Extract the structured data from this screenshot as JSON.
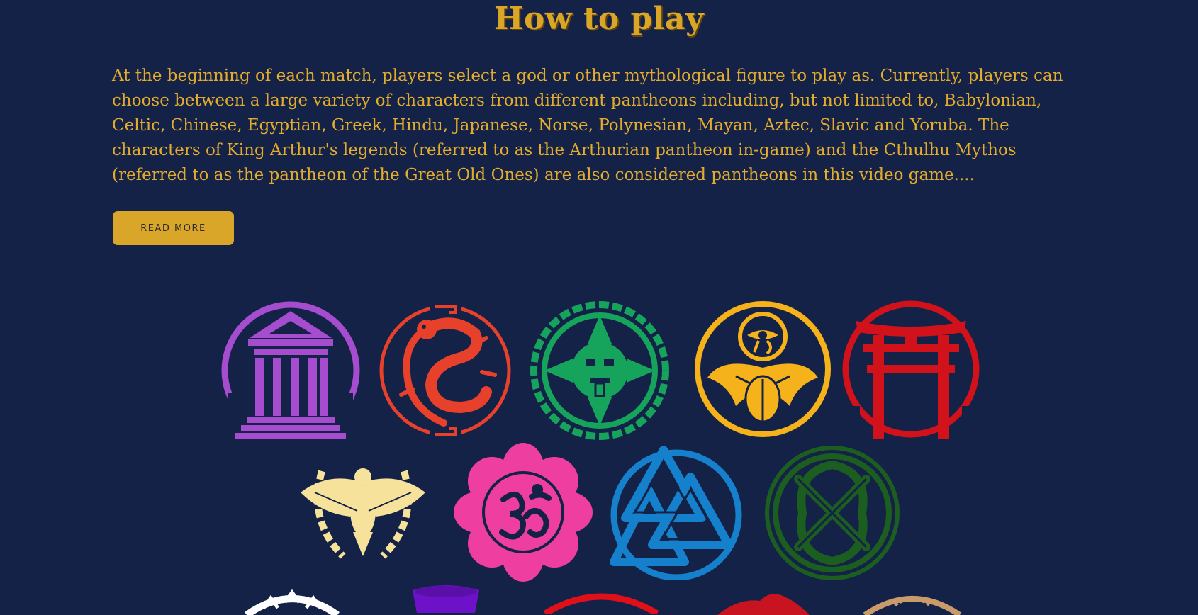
{
  "section": {
    "title": "How to play",
    "description": "At the beginning of each match, players select a god or other mythological figure to play as. Currently, players can choose between a large variety of characters from different pantheons including, but not limited to, Babylonian, Celtic, Chinese, Egyptian, Greek, Hindu, Japanese, Norse, Polynesian, Mayan, Aztec, Slavic and Yoruba. The characters of King Arthur's legends (referred to as the Arthurian pantheon in-game) and the Cthulhu Mythos (referred to as the pantheon of the Great Old Ones) are also considered pantheons in this video game....",
    "read_more_label": "READ MORE"
  },
  "colors": {
    "background": "#152247",
    "accent": "#d9a628",
    "greek": "#a54ccf",
    "chinese": "#e8412b",
    "mayan": "#16a35c",
    "egyptian": "#f5b21b",
    "japanese": "#d1121b",
    "roman": "#f6e29a",
    "hindu": "#ee3fa0",
    "norse": "#1580cc",
    "celtic": "#1b5e20"
  },
  "emblems": [
    {
      "icon": "greek-temple-icon"
    },
    {
      "icon": "chinese-dragon-icon"
    },
    {
      "icon": "mayan-sun-icon"
    },
    {
      "icon": "egyptian-scarab-icon"
    },
    {
      "icon": "japanese-torii-icon"
    },
    {
      "icon": "roman-eagle-icon"
    },
    {
      "icon": "hindu-om-lotus-icon"
    },
    {
      "icon": "norse-valknut-icon"
    },
    {
      "icon": "celtic-knot-icon"
    },
    {
      "icon": "voodoo-icon"
    },
    {
      "icon": "purple-emblem-icon"
    },
    {
      "icon": "red-emblem-icon"
    },
    {
      "icon": "red-bird-icon"
    },
    {
      "icon": "tan-emblem-icon"
    }
  ]
}
